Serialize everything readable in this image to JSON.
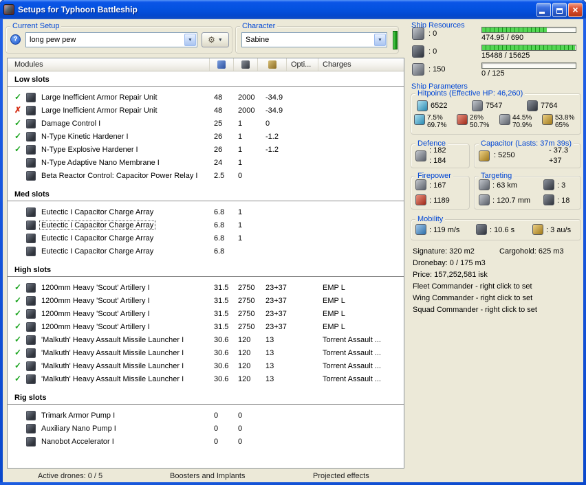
{
  "window": {
    "title": "Setups for Typhoon Battleship"
  },
  "glyphs": {
    "help": "?",
    "dropdown_arrow": "▼",
    "tools": "⚙",
    "check": "✓",
    "cross": "✗",
    "close": "×"
  },
  "current_setup": {
    "label": "Current Setup",
    "value": "long pew pew"
  },
  "character": {
    "label": "Character",
    "value": "Sabine"
  },
  "modules": {
    "header": {
      "modules": "Modules",
      "opti": "Opti...",
      "charges": "Charges"
    },
    "sections": [
      {
        "title": "Low slots",
        "rows": [
          {
            "status": "ok",
            "name": "Large Inefficient Armor Repair Unit",
            "c1": "48",
            "c2": "2000",
            "c3": "-34.9",
            "charge": ""
          },
          {
            "status": "fail",
            "name": "Large Inefficient Armor Repair Unit",
            "c1": "48",
            "c2": "2000",
            "c3": "-34.9",
            "charge": ""
          },
          {
            "status": "ok",
            "name": "Damage Control I",
            "c1": "25",
            "c2": "1",
            "c3": "0",
            "charge": ""
          },
          {
            "status": "ok",
            "name": "N-Type Kinetic Hardener I",
            "c1": "26",
            "c2": "1",
            "c3": "-1.2",
            "charge": ""
          },
          {
            "status": "ok",
            "name": "N-Type Explosive Hardener I",
            "c1": "26",
            "c2": "1",
            "c3": "-1.2",
            "charge": ""
          },
          {
            "status": "none",
            "name": "N-Type Adaptive Nano Membrane I",
            "c1": "24",
            "c2": "1",
            "c3": "",
            "charge": ""
          },
          {
            "status": "none",
            "name": "Beta Reactor Control: Capacitor Power Relay I",
            "c1": "2.5",
            "c2": "0",
            "c3": "",
            "charge": ""
          }
        ]
      },
      {
        "title": "Med slots",
        "rows": [
          {
            "status": "none",
            "name": "Eutectic I Capacitor Charge Array",
            "c1": "6.8",
            "c2": "1",
            "c3": "",
            "charge": ""
          },
          {
            "status": "none",
            "name": "Eutectic I Capacitor Charge Array",
            "c1": "6.8",
            "c2": "1",
            "c3": "",
            "charge": "",
            "focused": true
          },
          {
            "status": "none",
            "name": "Eutectic I Capacitor Charge Array",
            "c1": "6.8",
            "c2": "1",
            "c3": "",
            "charge": ""
          },
          {
            "status": "none",
            "name": "Eutectic I Capacitor Charge Array",
            "c1": "6.8",
            "c2": "",
            "c3": "",
            "charge": ""
          }
        ]
      },
      {
        "title": "High slots",
        "rows": [
          {
            "status": "ok",
            "name": "1200mm Heavy 'Scout' Artillery I",
            "c1": "31.5",
            "c2": "2750",
            "c3": "23+37",
            "charge": "EMP L"
          },
          {
            "status": "ok",
            "name": "1200mm Heavy 'Scout' Artillery I",
            "c1": "31.5",
            "c2": "2750",
            "c3": "23+37",
            "charge": "EMP L"
          },
          {
            "status": "ok",
            "name": "1200mm Heavy 'Scout' Artillery I",
            "c1": "31.5",
            "c2": "2750",
            "c3": "23+37",
            "charge": "EMP L"
          },
          {
            "status": "ok",
            "name": "1200mm Heavy 'Scout' Artillery I",
            "c1": "31.5",
            "c2": "2750",
            "c3": "23+37",
            "charge": "EMP L"
          },
          {
            "status": "ok",
            "name": "'Malkuth' Heavy Assault Missile Launcher I",
            "c1": "30.6",
            "c2": "120",
            "c3": "13",
            "charge": "Torrent Assault ..."
          },
          {
            "status": "ok",
            "name": "'Malkuth' Heavy Assault Missile Launcher I",
            "c1": "30.6",
            "c2": "120",
            "c3": "13",
            "charge": "Torrent Assault ..."
          },
          {
            "status": "ok",
            "name": "'Malkuth' Heavy Assault Missile Launcher I",
            "c1": "30.6",
            "c2": "120",
            "c3": "13",
            "charge": "Torrent Assault ..."
          },
          {
            "status": "ok",
            "name": "'Malkuth' Heavy Assault Missile Launcher I",
            "c1": "30.6",
            "c2": "120",
            "c3": "13",
            "charge": "Torrent Assault ..."
          }
        ]
      },
      {
        "title": "Rig slots",
        "rows": [
          {
            "status": "none",
            "name": "Trimark Armor Pump I",
            "c1": "0",
            "c2": "0",
            "c3": "",
            "charge": ""
          },
          {
            "status": "none",
            "name": "Auxiliary Nano Pump I",
            "c1": "0",
            "c2": "0",
            "c3": "",
            "charge": ""
          },
          {
            "status": "none",
            "name": "Nanobot Accelerator I",
            "c1": "0",
            "c2": "0",
            "c3": "",
            "charge": ""
          }
        ]
      }
    ]
  },
  "footer": {
    "active_drones": "Active drones: 0 / 5",
    "boosters": "Boosters and Implants",
    "projected": "Projected effects"
  },
  "ship_resources": {
    "label": "Ship Resources",
    "rows": [
      {
        "value": ": 0",
        "pct": 69,
        "text": "474.95 / 690"
      },
      {
        "value": ": 0",
        "pct": 99,
        "text": "15488 / 15625"
      },
      {
        "value": ": 150",
        "pct": 0,
        "text": "0 / 125"
      }
    ]
  },
  "ship_parameters": {
    "label": "Ship Parameters",
    "hitpoints": {
      "title": "Hitpoints (Effective HP: 46,260)",
      "shield": "6522",
      "armor": "7547",
      "hull": "7764",
      "resists": [
        {
          "top": "7.5%",
          "bottom": "69.7%"
        },
        {
          "top": "26%",
          "bottom": "50.7%"
        },
        {
          "top": "44.5%",
          "bottom": "70.9%"
        },
        {
          "top": "53.8%",
          "bottom": "65%"
        }
      ]
    },
    "defence": {
      "title": "Defence",
      "v1": ": 182",
      "v2": ": 184"
    },
    "capacitor": {
      "title": "Capacitor (Lasts: 37m 39s)",
      "amount": ": 5250",
      "out": "- 37.3",
      "in": "+37"
    },
    "firepower": {
      "title": "Firepower",
      "volley": ": 167",
      "dps": ": 1189"
    },
    "targeting": {
      "title": "Targeting",
      "range": ": 63 km",
      "max_targets": ": 3",
      "scan_res": ": 120.7 mm",
      "sensor_strength": ": 18"
    },
    "mobility": {
      "title": "Mobility",
      "speed": ": 119 m/s",
      "agility": ": 10.6 s",
      "warp": ": 3 au/s"
    },
    "info": {
      "signature": "Signature: 320 m2",
      "cargohold": "Cargohold: 625 m3",
      "dronebay": "Dronebay: 0 / 175 m3",
      "price": "Price: 157,252,581 isk",
      "fleet": "Fleet Commander - right click to set",
      "wing": "Wing Commander - right click to set",
      "squad": "Squad Commander - right click to set"
    }
  }
}
